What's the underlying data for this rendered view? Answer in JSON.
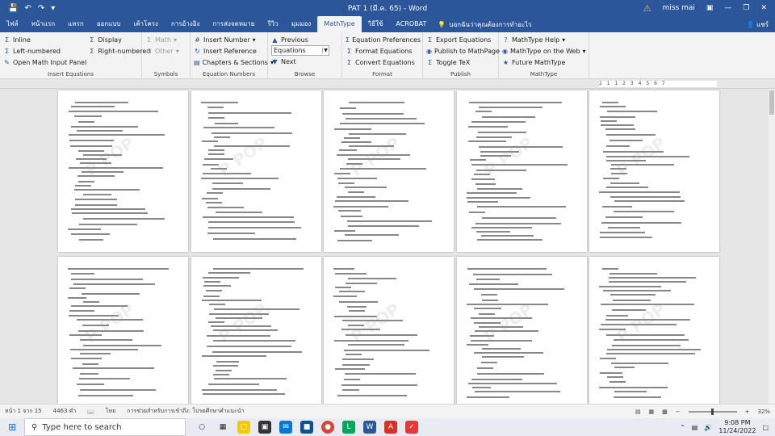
{
  "window": {
    "title": "PAT 1 (มี.ค. 65) - Word",
    "user": "miss mai"
  },
  "tabs": [
    "ไฟล์",
    "หน้าแรก",
    "แทรก",
    "ออกแบบ",
    "เค้าโครง",
    "การอ้างอิง",
    "การส่งจดหมาย",
    "รีวิว",
    "มุมมอง",
    "MathType",
    "วิธีใช้",
    "ACROBAT"
  ],
  "active_tab": "MathType",
  "tell_me": "บอกฉันว่าคุณต้องการทำอะไร",
  "share": "แชร์",
  "ribbon": {
    "insert_equations": {
      "label": "Insert Equations",
      "items": [
        "Inline",
        "Left-numbered",
        "Open Math Input Panel",
        "Display",
        "Right-numbered"
      ]
    },
    "symbols": {
      "label": "Symbols",
      "items": [
        "Math",
        "Other"
      ]
    },
    "equation_numbers": {
      "label": "Equation Numbers",
      "items": [
        "Insert Number",
        "Insert Reference",
        "Chapters & Sections"
      ]
    },
    "browse": {
      "label": "Browse",
      "previous": "Previous",
      "combo": "Equations",
      "next": "Next"
    },
    "format": {
      "label": "Format",
      "items": [
        "Equation Preferences",
        "Format Equations",
        "Convert Equations"
      ]
    },
    "publish": {
      "label": "Publish",
      "items": [
        "Export Equations",
        "Publish to MathPage",
        "Toggle TeX"
      ]
    },
    "mathtype": {
      "label": "MathType",
      "items": [
        "MathType Help",
        "MathType on the Web",
        "Future MathType"
      ]
    }
  },
  "ruler": "2 1 1 2 3 4 5 6 7",
  "status": {
    "page": "หน้า 1 จาก 15",
    "words": "4463 คำ",
    "lang": "ไทย",
    "accessibility": "การช่วยสำหรับการเข้าถึง: โปรดศึกษาคำแนะนำ",
    "zoom": "32%"
  },
  "taskbar": {
    "search_placeholder": "Type here to search",
    "time": "9:08 PM",
    "date": "11/24/2022"
  },
  "watermark": "P POP"
}
